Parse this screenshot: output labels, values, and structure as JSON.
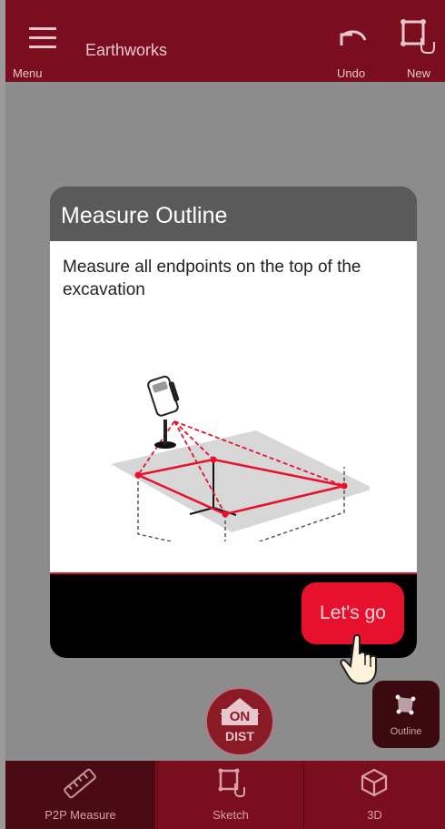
{
  "app": {
    "title": "Earthworks",
    "accent": "#e8112d",
    "bar_color": "#7a0e1f"
  },
  "topbar": {
    "menu_label": "Menu",
    "undo_label": "Undo",
    "new_label": "New"
  },
  "dialog": {
    "title": "Measure Outline",
    "text": "Measure all endpoints on the top of the excavation",
    "primary_button": "Let's go"
  },
  "controls": {
    "on_label": "ON",
    "dist_label": "DIST",
    "outline_label": "Outline"
  },
  "bottom_nav": {
    "tabs": [
      {
        "label": "P2P Measure",
        "icon": "ruler-icon",
        "active": true
      },
      {
        "label": "Sketch",
        "icon": "sketch-icon",
        "active": false
      },
      {
        "label": "3D",
        "icon": "cube-icon",
        "active": false
      }
    ]
  }
}
